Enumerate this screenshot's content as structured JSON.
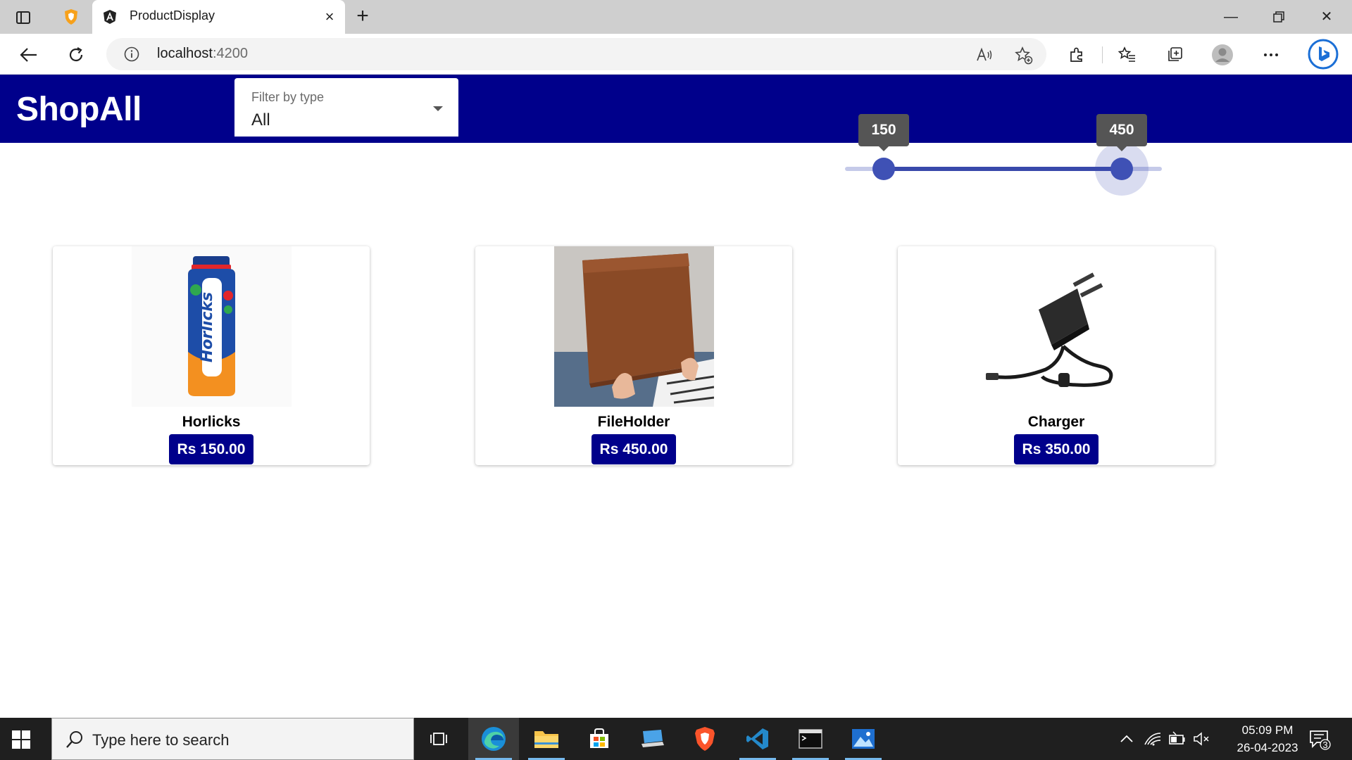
{
  "browser": {
    "tab_title": "ProductDisplay",
    "url_host": "localhost",
    "url_port": ":4200"
  },
  "app": {
    "brand": "ShopAll",
    "filter": {
      "label": "Filter by type",
      "value": "All"
    },
    "price_range": {
      "min_label": "150",
      "max_label": "450",
      "min_value": 150,
      "max_value": 450
    }
  },
  "products": [
    {
      "name": "Horlicks",
      "price": "Rs 150.00"
    },
    {
      "name": "FileHolder",
      "price": "Rs 450.00"
    },
    {
      "name": "Charger",
      "price": "Rs 350.00"
    }
  ],
  "taskbar": {
    "search_placeholder": "Type here to search",
    "time": "05:09 PM",
    "date": "26-04-2023",
    "notification_count": "3"
  },
  "colors": {
    "header_bg": "#00008b",
    "slider_accent": "#3f51b5",
    "price_badge": "#00008b"
  }
}
